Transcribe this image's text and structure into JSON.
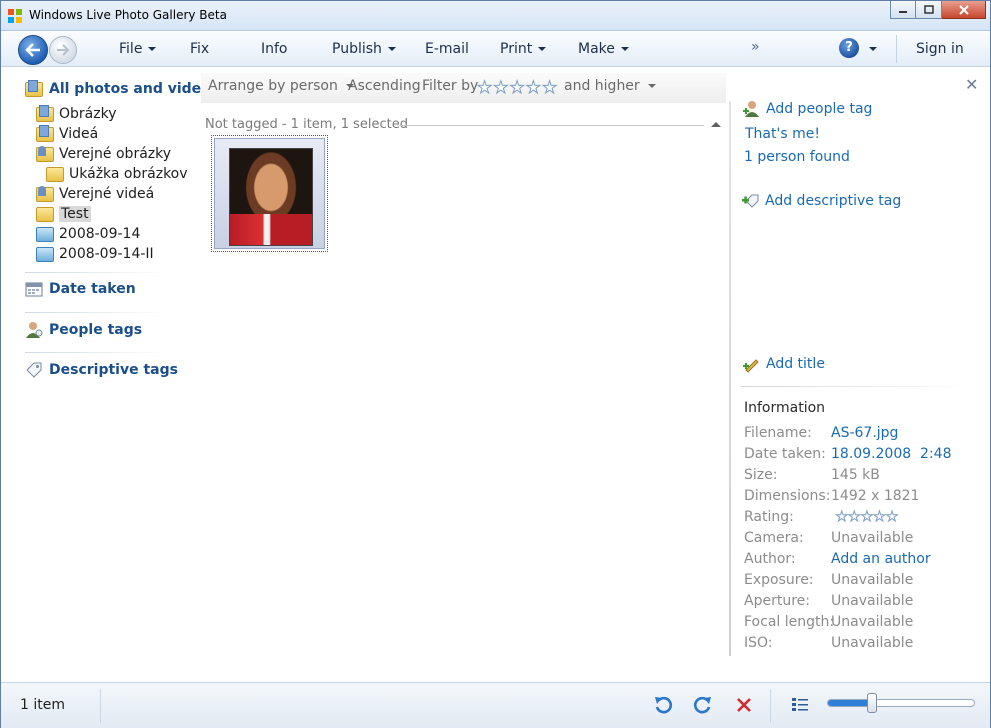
{
  "window": {
    "title": "Windows Live Photo Gallery Beta"
  },
  "toolbar": {
    "menus": [
      {
        "label": "File",
        "has_arrow": true
      },
      {
        "label": "Fix",
        "has_arrow": false
      },
      {
        "label": "Info",
        "has_arrow": false
      },
      {
        "label": "Publish",
        "has_arrow": true
      },
      {
        "label": "E-mail",
        "has_arrow": false
      },
      {
        "label": "Print",
        "has_arrow": true
      },
      {
        "label": "Make",
        "has_arrow": true
      }
    ],
    "more": "»",
    "help": "?",
    "sign_in": "Sign in"
  },
  "leftnav": {
    "all_photos": "All photos and videos",
    "folders": [
      {
        "label": "Obrázky",
        "icon": "folder-pictures-icon"
      },
      {
        "label": "Videá",
        "icon": "folder-videos-icon"
      },
      {
        "label": "Verejné obrázky",
        "icon": "folder-public-pictures-icon"
      },
      {
        "label": "Ukážka obrázkov",
        "icon": "folder-icon"
      },
      {
        "label": "Verejné videá",
        "icon": "folder-public-videos-icon"
      },
      {
        "label": "Test",
        "icon": "folder-icon",
        "selected": true
      },
      {
        "label": "2008-09-14",
        "icon": "imported-icon"
      },
      {
        "label": "2008-09-14-II",
        "icon": "imported-icon"
      }
    ],
    "date_taken": "Date taken",
    "people_tags": "People tags",
    "descriptive_tags": "Descriptive tags"
  },
  "filterbar": {
    "arrange": "Arrange by person",
    "order": "Ascending",
    "filter": "Filter by",
    "and_higher": "and higher",
    "filter_rating": 0
  },
  "gallery": {
    "group_label": "Not tagged - 1 item, 1 selected"
  },
  "rightpane": {
    "add_people_tag": "Add people tag",
    "thats_me": "That's me!",
    "persons_found": "1 person found",
    "add_descriptive_tag": "Add descriptive tag",
    "add_title": "Add title",
    "info_heading": "Information",
    "info": [
      {
        "key": "Filename:",
        "value": "AS-67.jpg",
        "link": true
      },
      {
        "key": "Date taken:",
        "value": "18.09.2008  2:48",
        "link": true
      },
      {
        "key": "Size:",
        "value": "145 kB",
        "link": false
      },
      {
        "key": "Dimensions:",
        "value": "1492 x 1821",
        "link": false
      },
      {
        "key": "Rating:",
        "value": "",
        "link": false
      },
      {
        "key": "Camera:",
        "value": "Unavailable",
        "link": false
      },
      {
        "key": "Author:",
        "value": "Add an author",
        "link": true
      },
      {
        "key": "Exposure:",
        "value": "Unavailable",
        "link": false
      },
      {
        "key": "Aperture:",
        "value": "Unavailable",
        "link": false
      },
      {
        "key": "Focal length:",
        "value": "Unavailable",
        "link": false
      },
      {
        "key": "ISO:",
        "value": "Unavailable",
        "link": false
      }
    ],
    "rating_value": 0
  },
  "statusbar": {
    "count": "1 item",
    "zoom_level": 0.3
  }
}
